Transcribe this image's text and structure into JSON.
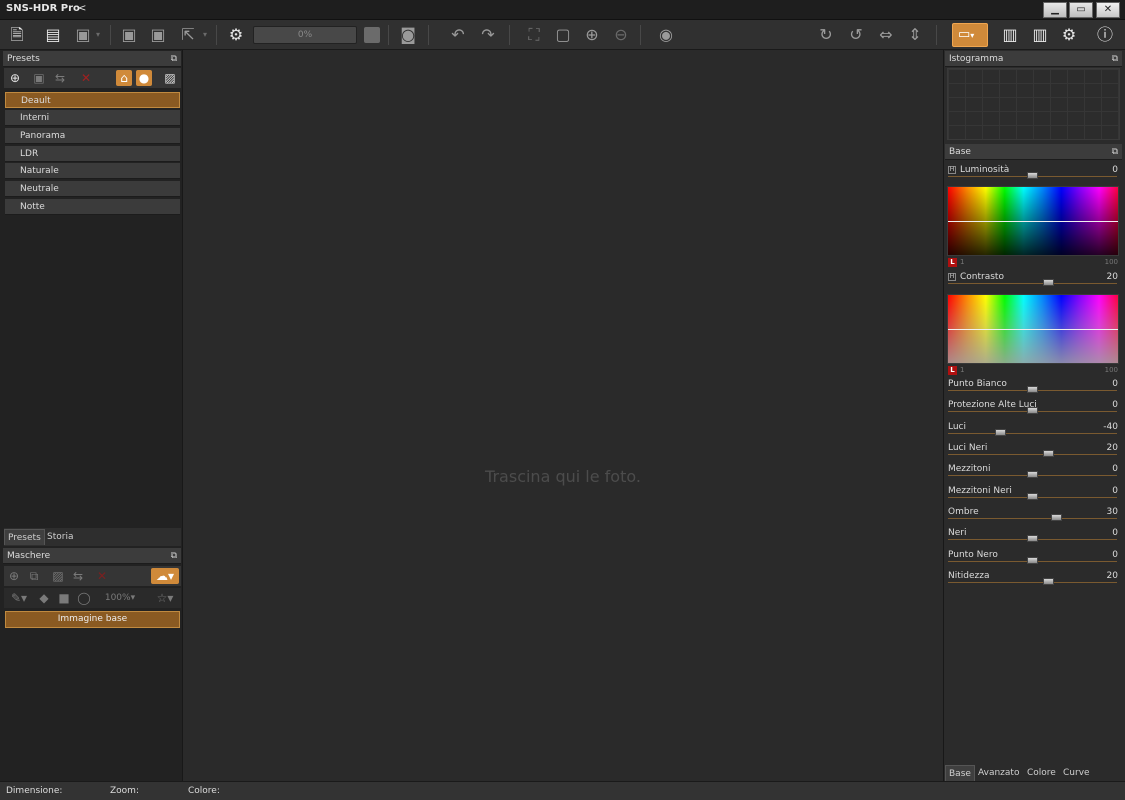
{
  "window": {
    "title": "SNS-HDR Pro",
    "collapse_glyph": "<",
    "controls": [
      "minimize",
      "maximize",
      "close"
    ]
  },
  "toolbar": {
    "progress_text": "0%",
    "icons": [
      "open-image",
      "open-sns",
      "save-dropdown",
      "save",
      "save-as",
      "export",
      "process-settings",
      "stop",
      "snapshot",
      "undo",
      "redo",
      "fit",
      "crop",
      "zoom-in",
      "zoom-out",
      "preview",
      "rotate-cw",
      "rotate-ccw",
      "flip-horizontal",
      "flip-vertical",
      "monitor",
      "layout-1",
      "layout-2",
      "settings",
      "info"
    ]
  },
  "presets_panel": {
    "title": "Presets",
    "items": [
      "Deault",
      "Interni",
      "Panorama",
      "LDR",
      "Naturale",
      "Neutrale",
      "Notte"
    ],
    "selected_index": 0
  },
  "left_tabs": [
    "Presets",
    "Storia"
  ],
  "masks_panel": {
    "title": "Maschere",
    "opacity": "100%",
    "base_layer": "Immagine base"
  },
  "center": {
    "drop_message": "Trascina qui le foto."
  },
  "histogram_panel": {
    "title": "Istogramma"
  },
  "base_panel": {
    "title": "Base",
    "spectrum_min": "1",
    "spectrum_max": "100",
    "spectrum_badge": "L",
    "hsl_marker": "H",
    "luminosita": {
      "label": "Luminosità",
      "value": "0"
    },
    "contrasto": {
      "label": "Contrasto",
      "value": "20"
    },
    "sliders": [
      {
        "label": "Punto Bianco",
        "value": "0"
      },
      {
        "label": "Protezione Alte Luci",
        "value": "0"
      },
      {
        "label": "Luci",
        "value": "-40"
      },
      {
        "label": "Luci Neri",
        "value": "20"
      },
      {
        "label": "Mezzitoni",
        "value": "0"
      },
      {
        "label": "Mezzitoni Neri",
        "value": "0"
      },
      {
        "label": "Ombre",
        "value": "30"
      },
      {
        "label": "Neri",
        "value": "0"
      },
      {
        "label": "Punto Nero",
        "value": "0"
      },
      {
        "label": "Nitidezza",
        "value": "20"
      }
    ]
  },
  "right_tabs": [
    "Base",
    "Avanzato",
    "Colore",
    "Curve"
  ],
  "status": {
    "dimensione": "Dimensione:",
    "zoom": "Zoom:",
    "colore": "Colore:"
  },
  "colors": {
    "accent": "#d08a3a",
    "selected_bg": "#8a5a22",
    "panel_bg": "#222222",
    "canvas_bg": "#2a2a2a"
  }
}
